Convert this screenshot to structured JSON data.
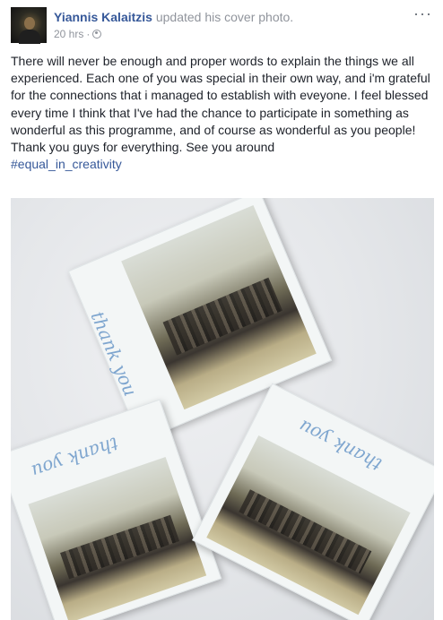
{
  "post": {
    "author": "Yiannis Kalaitzis",
    "action": "updated his cover photo.",
    "time": "20 hrs",
    "time_sep": "·",
    "privacy_icon": "globe-icon",
    "more_label": "···",
    "paragraphs": [
      "There will never be enough and proper words to explain the things we all experienced. Each one of you was special in their own way, and i'm grateful for the connections that i managed to establish with eveyone. I feel blessed every time I think that I've had the chance to participate in something as wonderful as this programme, and of course as wonderful as you people!",
      "Thank you guys for everything. See you around"
    ],
    "hashtag": "#equal_in_creativity"
  },
  "photo": {
    "captions": [
      "thank you",
      "thank you",
      "thank you"
    ]
  },
  "colors": {
    "author_link": "#365899",
    "meta_text": "#90949c",
    "body_text": "#1d2129",
    "caption_ink": "#7fa6cf"
  }
}
